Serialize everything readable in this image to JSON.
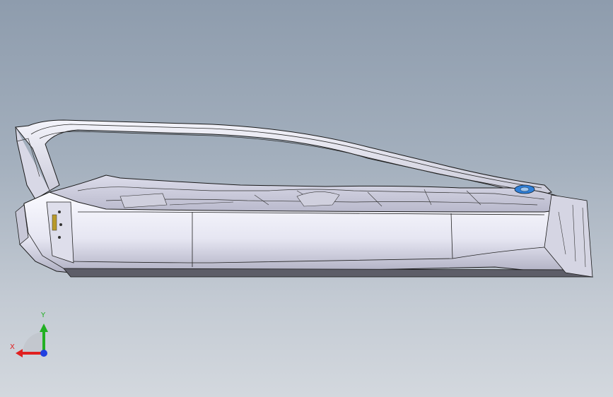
{
  "viewport": {
    "background_top": "#8e9cad",
    "background_bottom": "#d3d8de"
  },
  "model": {
    "part": "car-door-inner-panel",
    "body_color": "#e8e8f4",
    "edge_color": "#1a1a1a",
    "accent_color": "#2f7fd8"
  },
  "triad": {
    "x_label": "X",
    "y_label": "Y",
    "x_color": "#e02020",
    "y_color": "#22b022",
    "z_color": "#2040e0"
  }
}
